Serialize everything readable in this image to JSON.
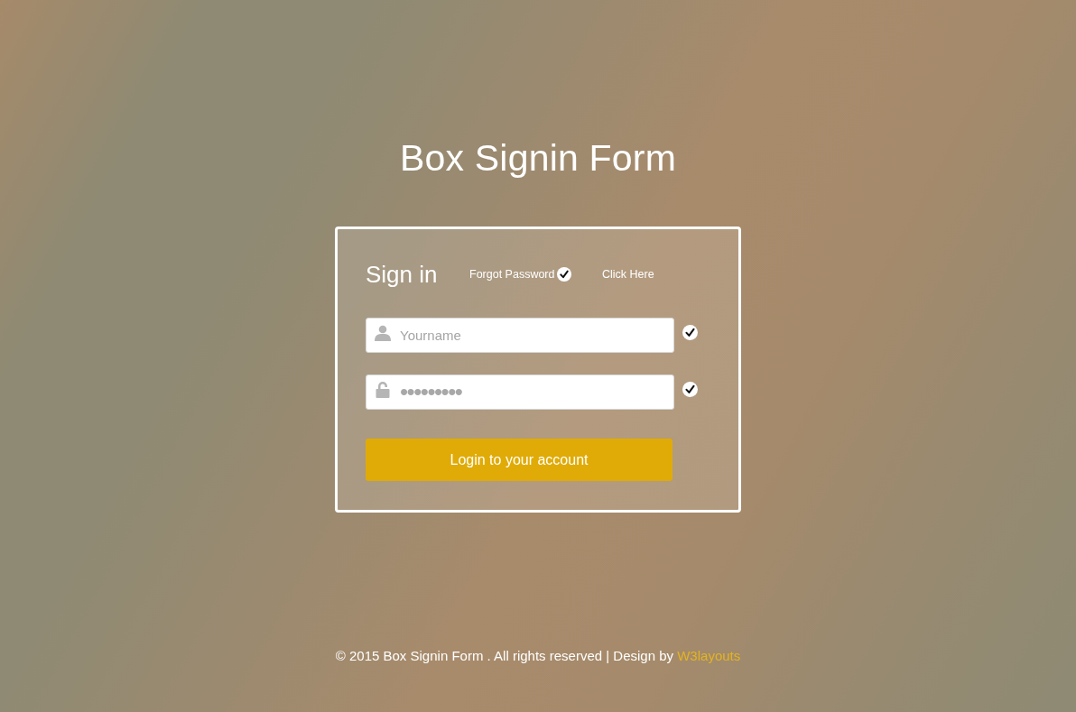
{
  "page": {
    "title": "Box Signin Form"
  },
  "form": {
    "heading": "Sign in",
    "links": [
      {
        "kind": "forgot",
        "label": "Forgot Password"
      },
      {
        "kind": "plain",
        "label": "Click Here"
      }
    ],
    "fields": [
      {
        "kind": "username",
        "placeholder": "Yourname",
        "valid": true
      },
      {
        "kind": "password",
        "value": "•••••••••",
        "valid": true
      }
    ],
    "submit": "Login to your account"
  },
  "footer": {
    "text": "© 2015 Box Signin Form . All rights reserved | Design by",
    "link": "W3layouts"
  }
}
